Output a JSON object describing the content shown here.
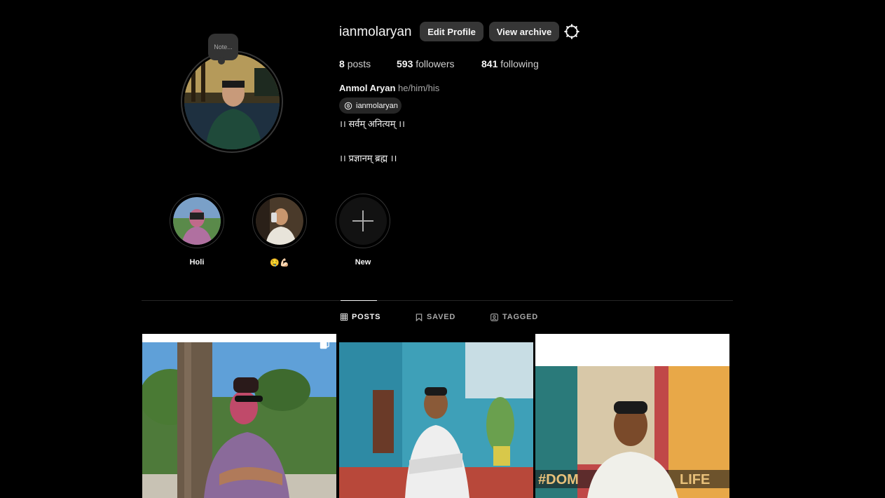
{
  "profile": {
    "note_text": "Note...",
    "username": "ianmolaryan",
    "edit_profile_label": "Edit Profile",
    "view_archive_label": "View archive",
    "stats": {
      "posts_count": "8",
      "posts_label": "posts",
      "followers_count": "593",
      "followers_label": "followers",
      "following_count": "841",
      "following_label": "following"
    },
    "full_name": "Anmol Aryan",
    "pronouns": "he/him/his",
    "threads_handle": "ianmolaryan",
    "bio_line1": "।। सर्वम् अनित्यम् ।।",
    "bio_line2": "।। प्रज्ञानम् ब्रह्म ।।"
  },
  "highlights": [
    {
      "label": "Holi"
    },
    {
      "label": "🤤💪🏻"
    },
    {
      "label": "New"
    }
  ],
  "tabs": [
    {
      "label": "POSTS",
      "icon": "grid-icon",
      "active": true
    },
    {
      "label": "SAVED",
      "icon": "bookmark-icon",
      "active": false
    },
    {
      "label": "TAGGED",
      "icon": "tagged-icon",
      "active": false
    }
  ],
  "colors": {
    "background": "#000000",
    "button": "#363636",
    "text": "#f5f5f5",
    "muted": "#a8a8a8"
  }
}
